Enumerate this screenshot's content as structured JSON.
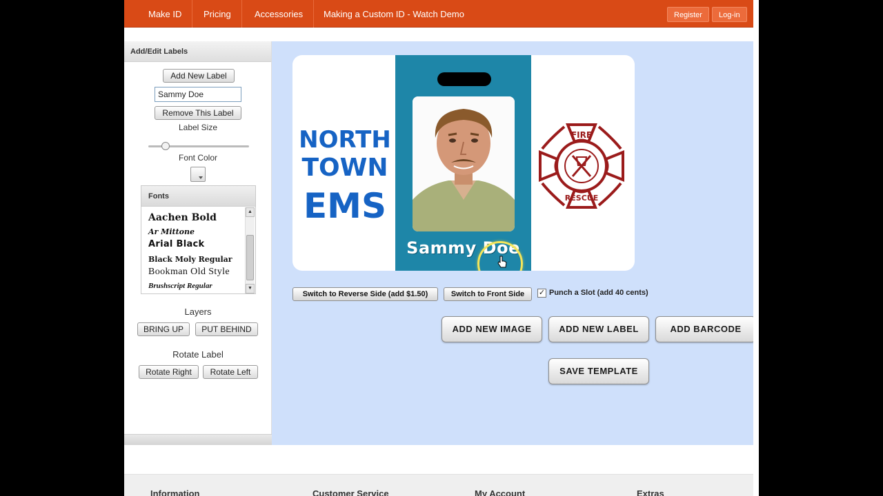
{
  "nav": {
    "items": [
      "Make ID",
      "Pricing",
      "Accessories",
      "Making a Custom ID - Watch Demo"
    ],
    "register": "Register",
    "login": "Log-in"
  },
  "panel": {
    "title": "Add/Edit Labels",
    "add_new_label": "Add New Label",
    "label_text_value": "Sammy Doe",
    "remove_label": "Remove This Label",
    "label_size": "Label Size",
    "label_size_level": 0.17,
    "font_color": "Font Color",
    "fonts_title": "Fonts",
    "fonts": [
      "Aachen Bold",
      "Ar Mittone",
      "Arial Black",
      "Black Moly Regular",
      "Bookman Old Style",
      "Brushscript Regular"
    ],
    "layers": "Layers",
    "bring_up": "BRING UP",
    "put_behind": "PUT BEHIND",
    "rotate_label": "Rotate Label",
    "rotate_right": "Rotate Right",
    "rotate_left": "Rotate Left"
  },
  "card": {
    "org_lines": [
      "NORTH",
      "TOWN",
      "EMS"
    ],
    "name": "Sammy Doe",
    "logo_top": "FIRE",
    "logo_bottom": "RESCUE",
    "colors": {
      "stripe": "#1e86a8",
      "org_text": "#1663c4",
      "logo": "#9b1b1b"
    }
  },
  "controls": {
    "switch_reverse": "Switch to Reverse Side (add $1.50)",
    "switch_front": "Switch to Front Side",
    "punch_slot_checked": true,
    "punch_slot": "Punch a Slot (add 40 cents)",
    "add_image": "ADD NEW IMAGE",
    "add_label": "ADD NEW LABEL",
    "add_barcode": "ADD BARCODE",
    "save_template": "SAVE TEMPLATE"
  },
  "footer": {
    "headings": [
      "Information",
      "Customer Service",
      "My Account",
      "Extras"
    ]
  },
  "colors": {
    "nav_bg": "#d94a16",
    "workspace_bg": "#cfe0fb"
  }
}
